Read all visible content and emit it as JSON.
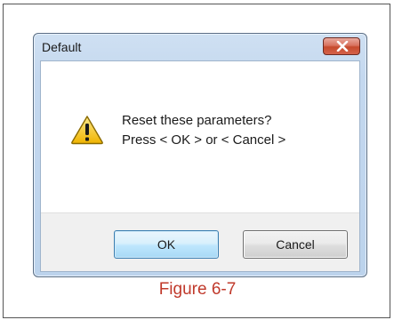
{
  "dialog": {
    "title": "Default",
    "message_line_1": "Reset these parameters?",
    "message_line_2": "Press < OK > or < Cancel >",
    "ok_label": "OK",
    "cancel_label": "Cancel",
    "icon": "warning-icon",
    "close_icon": "close-icon"
  },
  "caption": {
    "text": "Figure 6-7",
    "color": "#c0392b"
  },
  "colors": {
    "close_button": "#c64a2d",
    "ok_button_border": "#3c7fb1",
    "warning_yellow": "#f5c518"
  }
}
